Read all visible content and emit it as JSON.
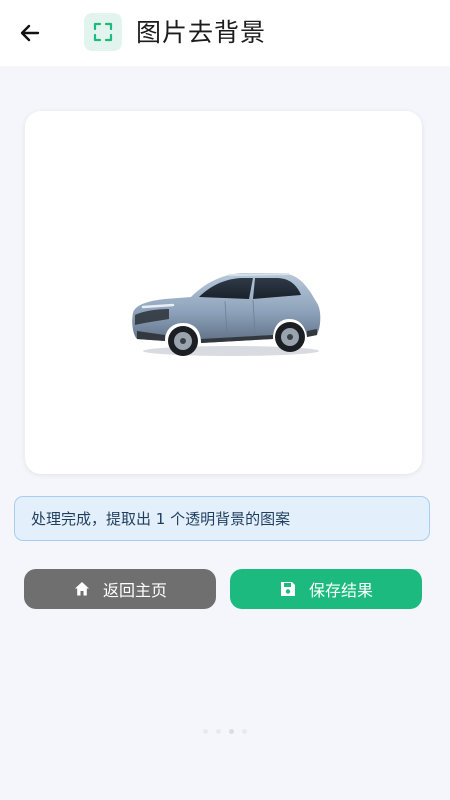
{
  "header": {
    "back_icon": "arrow-left-icon",
    "title_icon": "scan-frame-icon",
    "title": "图片去背景"
  },
  "preview": {
    "image": "car-cutout-transparent"
  },
  "status": {
    "message": "处理完成，提取出 1 个透明背景的图案"
  },
  "actions": {
    "home_label": "返回主页",
    "home_icon": "home-icon",
    "save_label": "保存结果",
    "save_icon": "floppy-disk-icon"
  },
  "pager": {
    "count": 4,
    "active_index": 2
  },
  "colors": {
    "accent": "#1cba7f",
    "secondary_button": "#6f6f6f",
    "status_bg": "#e3effb",
    "status_border": "#a9cdef"
  }
}
